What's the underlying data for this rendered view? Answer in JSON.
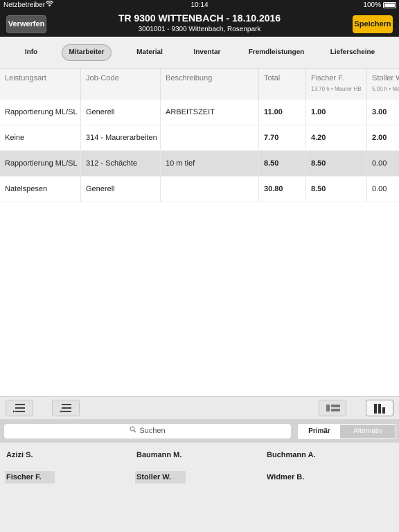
{
  "statusbar": {
    "carrier": "Netzbetreiber",
    "wifi_icon": "wifi-icon",
    "time": "10:14",
    "battery_pct": "100%"
  },
  "header": {
    "discard_label": "Verwerfen",
    "title": "TR 9300 WITTENBACH - 18.10.2016",
    "subtitle": "3001001 - 9300 Wittenbach, Rosenpark",
    "save_label": "Speichern",
    "save_color": "#f5b800"
  },
  "tabs": [
    {
      "label": "Info"
    },
    {
      "label": "Mitarbeiter",
      "active": true
    },
    {
      "label": "Material"
    },
    {
      "label": "Inventar"
    },
    {
      "label": "Fremdleistungen"
    },
    {
      "label": "Lieferscheine"
    }
  ],
  "table": {
    "columns": [
      {
        "label": "Leistungsart"
      },
      {
        "label": "Job-Code"
      },
      {
        "label": "Beschreibung"
      },
      {
        "label": "Total"
      },
      {
        "label": "Fischer F.",
        "sub": "13.70 h • Maurer HB"
      },
      {
        "label": "Stoller W.",
        "sub": "5.00 h • Ma"
      }
    ],
    "rows": [
      {
        "cells": [
          "Rapportierung ML/SL",
          "Generell",
          "ARBEITSZEIT",
          "11.00",
          "1.00",
          "3.00"
        ]
      },
      {
        "cells": [
          "Keine",
          "314 - Maurerarbeiten",
          "",
          "7.70",
          "4.20",
          "2.00"
        ]
      },
      {
        "cells": [
          "Rapportierung ML/SL",
          "312 - Schächte",
          "10 m tief",
          "8.50",
          "8.50",
          "0.00"
        ],
        "selected": true
      },
      {
        "cells": [
          "Natelspesen",
          "Generell",
          "",
          "30.80",
          "8.50",
          "0.00"
        ]
      }
    ]
  },
  "toolbar": {
    "buttons": [
      "add-row-icon",
      "remove-row-icon",
      "list-view-icon",
      "column-view-icon"
    ]
  },
  "search": {
    "placeholder": "Suchen",
    "icon": "search-icon"
  },
  "segment": {
    "primary": "Primär",
    "alternative": "Alternativ"
  },
  "employees": [
    {
      "name": "Azizi S."
    },
    {
      "name": "Baumann M."
    },
    {
      "name": "Buchmann A."
    },
    {
      "name": "Fischer F.",
      "selected": true
    },
    {
      "name": "Stoller W.",
      "selected": true
    },
    {
      "name": "Widmer B."
    }
  ]
}
